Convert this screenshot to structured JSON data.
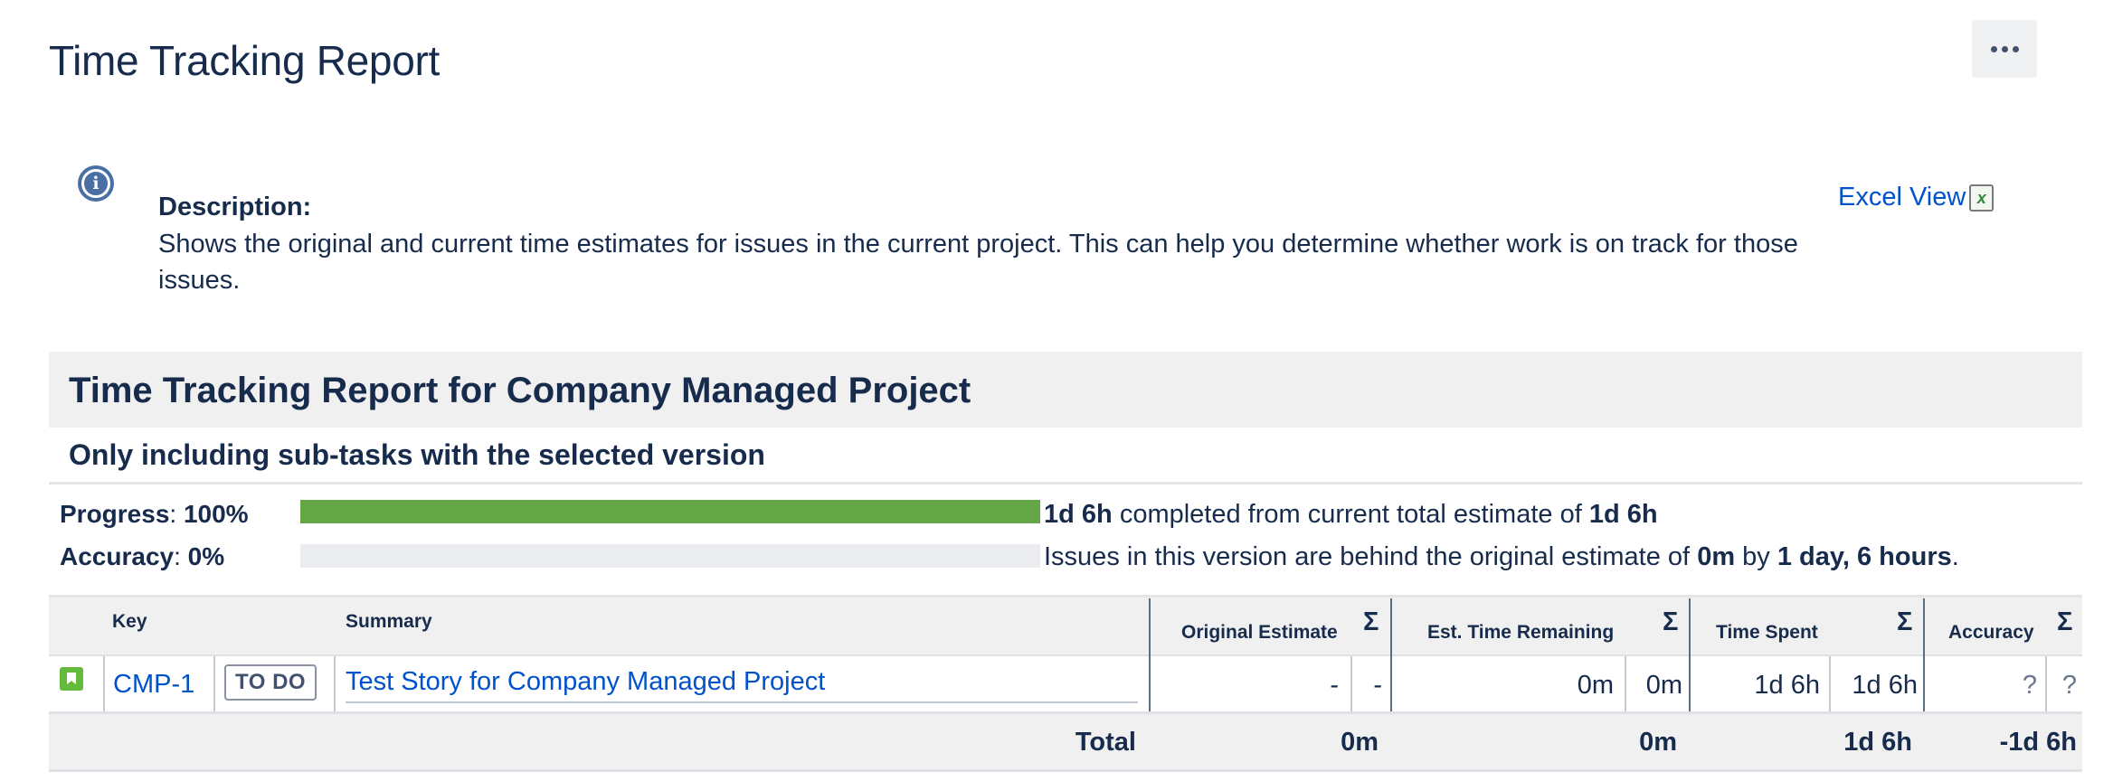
{
  "page": {
    "title": "Time Tracking Report",
    "more_icon": "more-horizontal-icon"
  },
  "description": {
    "label": "Description:",
    "text": "Shows the original and current time estimates for issues in the current project. This can help you determine whether work is on track for those issues.",
    "info_icon": "info-icon"
  },
  "excel": {
    "label": "Excel View",
    "icon_letter": "x",
    "icon": "excel-icon"
  },
  "report": {
    "title": "Time Tracking Report for Company Managed Project",
    "subtitle": "Only including sub-tasks with the selected version"
  },
  "progress": {
    "label": "Progress",
    "value": "100%",
    "fraction": 1.0,
    "spent": "1d 6h",
    "text_mid": "completed from current total estimate of",
    "estimate": "1d 6h",
    "color": "#63a645"
  },
  "accuracy": {
    "label": "Accuracy",
    "value": "0%",
    "fraction": 0.0,
    "text_start": "Issues in this version are behind the original estimate of",
    "original": "0m",
    "by": "by",
    "behind": "1 day, 6 hours",
    "end": "."
  },
  "table": {
    "headers": {
      "key": "Key",
      "summary": "Summary",
      "original_estimate": "Original Estimate",
      "remaining": "Est. Time Remaining",
      "time_spent": "Time Spent",
      "accuracy": "Accuracy",
      "sigma": "Σ"
    },
    "rows": [
      {
        "type_icon": "story-icon",
        "key": "CMP-1",
        "status": "TO DO",
        "summary": "Test Story for Company Managed Project",
        "original_estimate": "-",
        "original_estimate_sum": "-",
        "remaining": "0m",
        "remaining_sum": "0m",
        "time_spent": "1d 6h",
        "time_spent_sum": "1d 6h",
        "accuracy": "?",
        "accuracy_sum": "?"
      }
    ],
    "total": {
      "label": "Total",
      "original_estimate": "0m",
      "remaining": "0m",
      "time_spent": "1d 6h",
      "accuracy": "-1d 6h"
    }
  }
}
